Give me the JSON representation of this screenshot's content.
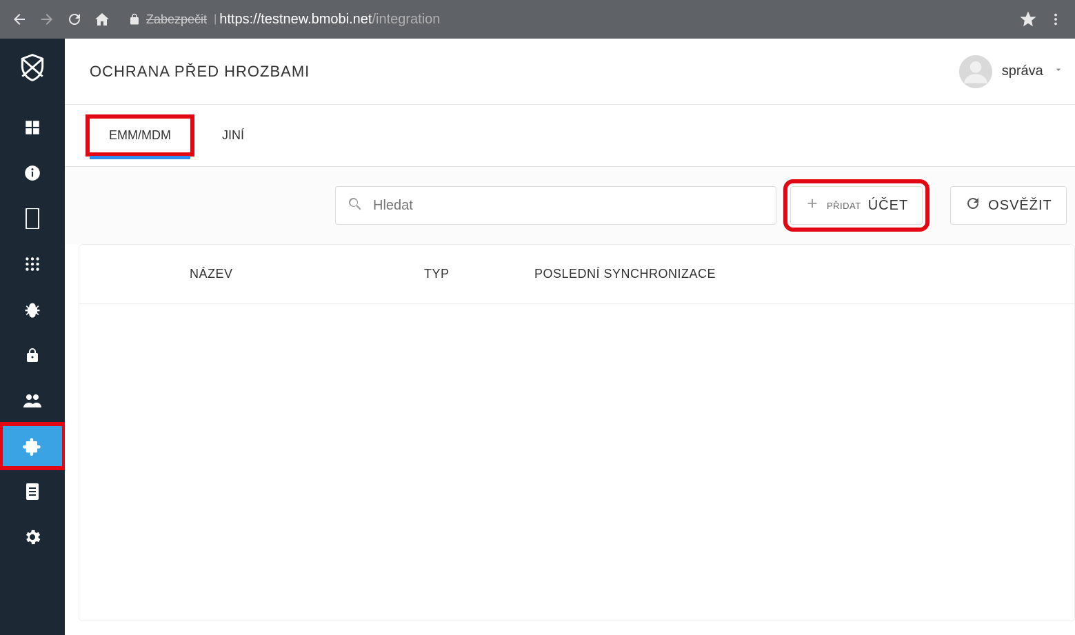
{
  "browser": {
    "secure_label": "Zabezpečit",
    "url_protocol_host": "https://testnew.bmobi.net",
    "url_path": "/integration"
  },
  "header": {
    "title": "OCHRANA PŘED HROZBAMI",
    "user_label": "správa"
  },
  "tabs": [
    {
      "label": "EMM/MDM",
      "active": true
    },
    {
      "label": "JINÍ",
      "active": false
    }
  ],
  "toolbar": {
    "search_placeholder": "Hledat",
    "add_small": "PŘIDAT",
    "add_big": "ÚČET",
    "refresh": "OSVĚŽIT"
  },
  "table": {
    "columns": {
      "name": "NÁZEV",
      "type": "TYP",
      "last_sync": "POSLEDNÍ SYNCHRONIZACE"
    },
    "rows": []
  },
  "sidebar": {
    "items": [
      "dashboard",
      "info",
      "device",
      "apps",
      "bug",
      "lock",
      "users",
      "integration",
      "document",
      "settings"
    ]
  }
}
